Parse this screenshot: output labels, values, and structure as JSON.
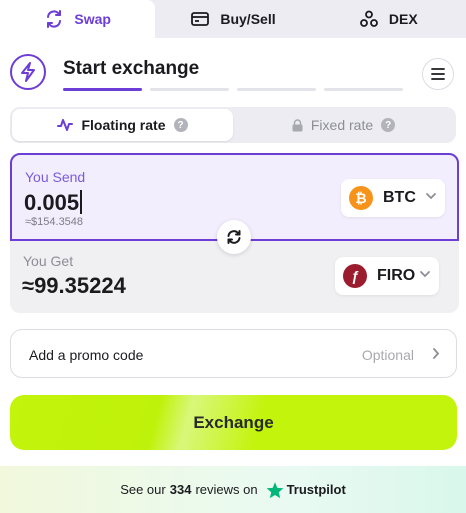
{
  "tabs": [
    {
      "label": "Swap",
      "icon": "swap-icon",
      "active": true
    },
    {
      "label": "Buy/Sell",
      "icon": "card-icon",
      "active": false
    },
    {
      "label": "DEX",
      "icon": "dex-icon",
      "active": false
    }
  ],
  "header": {
    "title": "Start exchange",
    "steps_total": 4,
    "steps_done": 1
  },
  "rate": {
    "floating_label": "Floating rate",
    "fixed_label": "Fixed rate",
    "help_glyph": "?"
  },
  "send": {
    "label": "You Send",
    "amount": "0.005",
    "usd_value": "≈$154.3548",
    "coin": "BTC",
    "coin_glyph": "₿",
    "coin_color": "#f7931a"
  },
  "get": {
    "label": "You Get",
    "amount": "≈99.35224",
    "coin": "FIRO",
    "coin_glyph": "ƒ",
    "coin_color": "#9b1c2e"
  },
  "promo": {
    "label": "Add a promo code",
    "optional_label": "Optional"
  },
  "exchange_button": "Exchange",
  "footer": {
    "prefix": "See our",
    "count": "334",
    "suffix": "reviews on",
    "brand": "Trustpilot",
    "brand_color": "#00b67a"
  },
  "colors": {
    "accent": "#6c3ed6",
    "cta": "#c3f40b"
  }
}
